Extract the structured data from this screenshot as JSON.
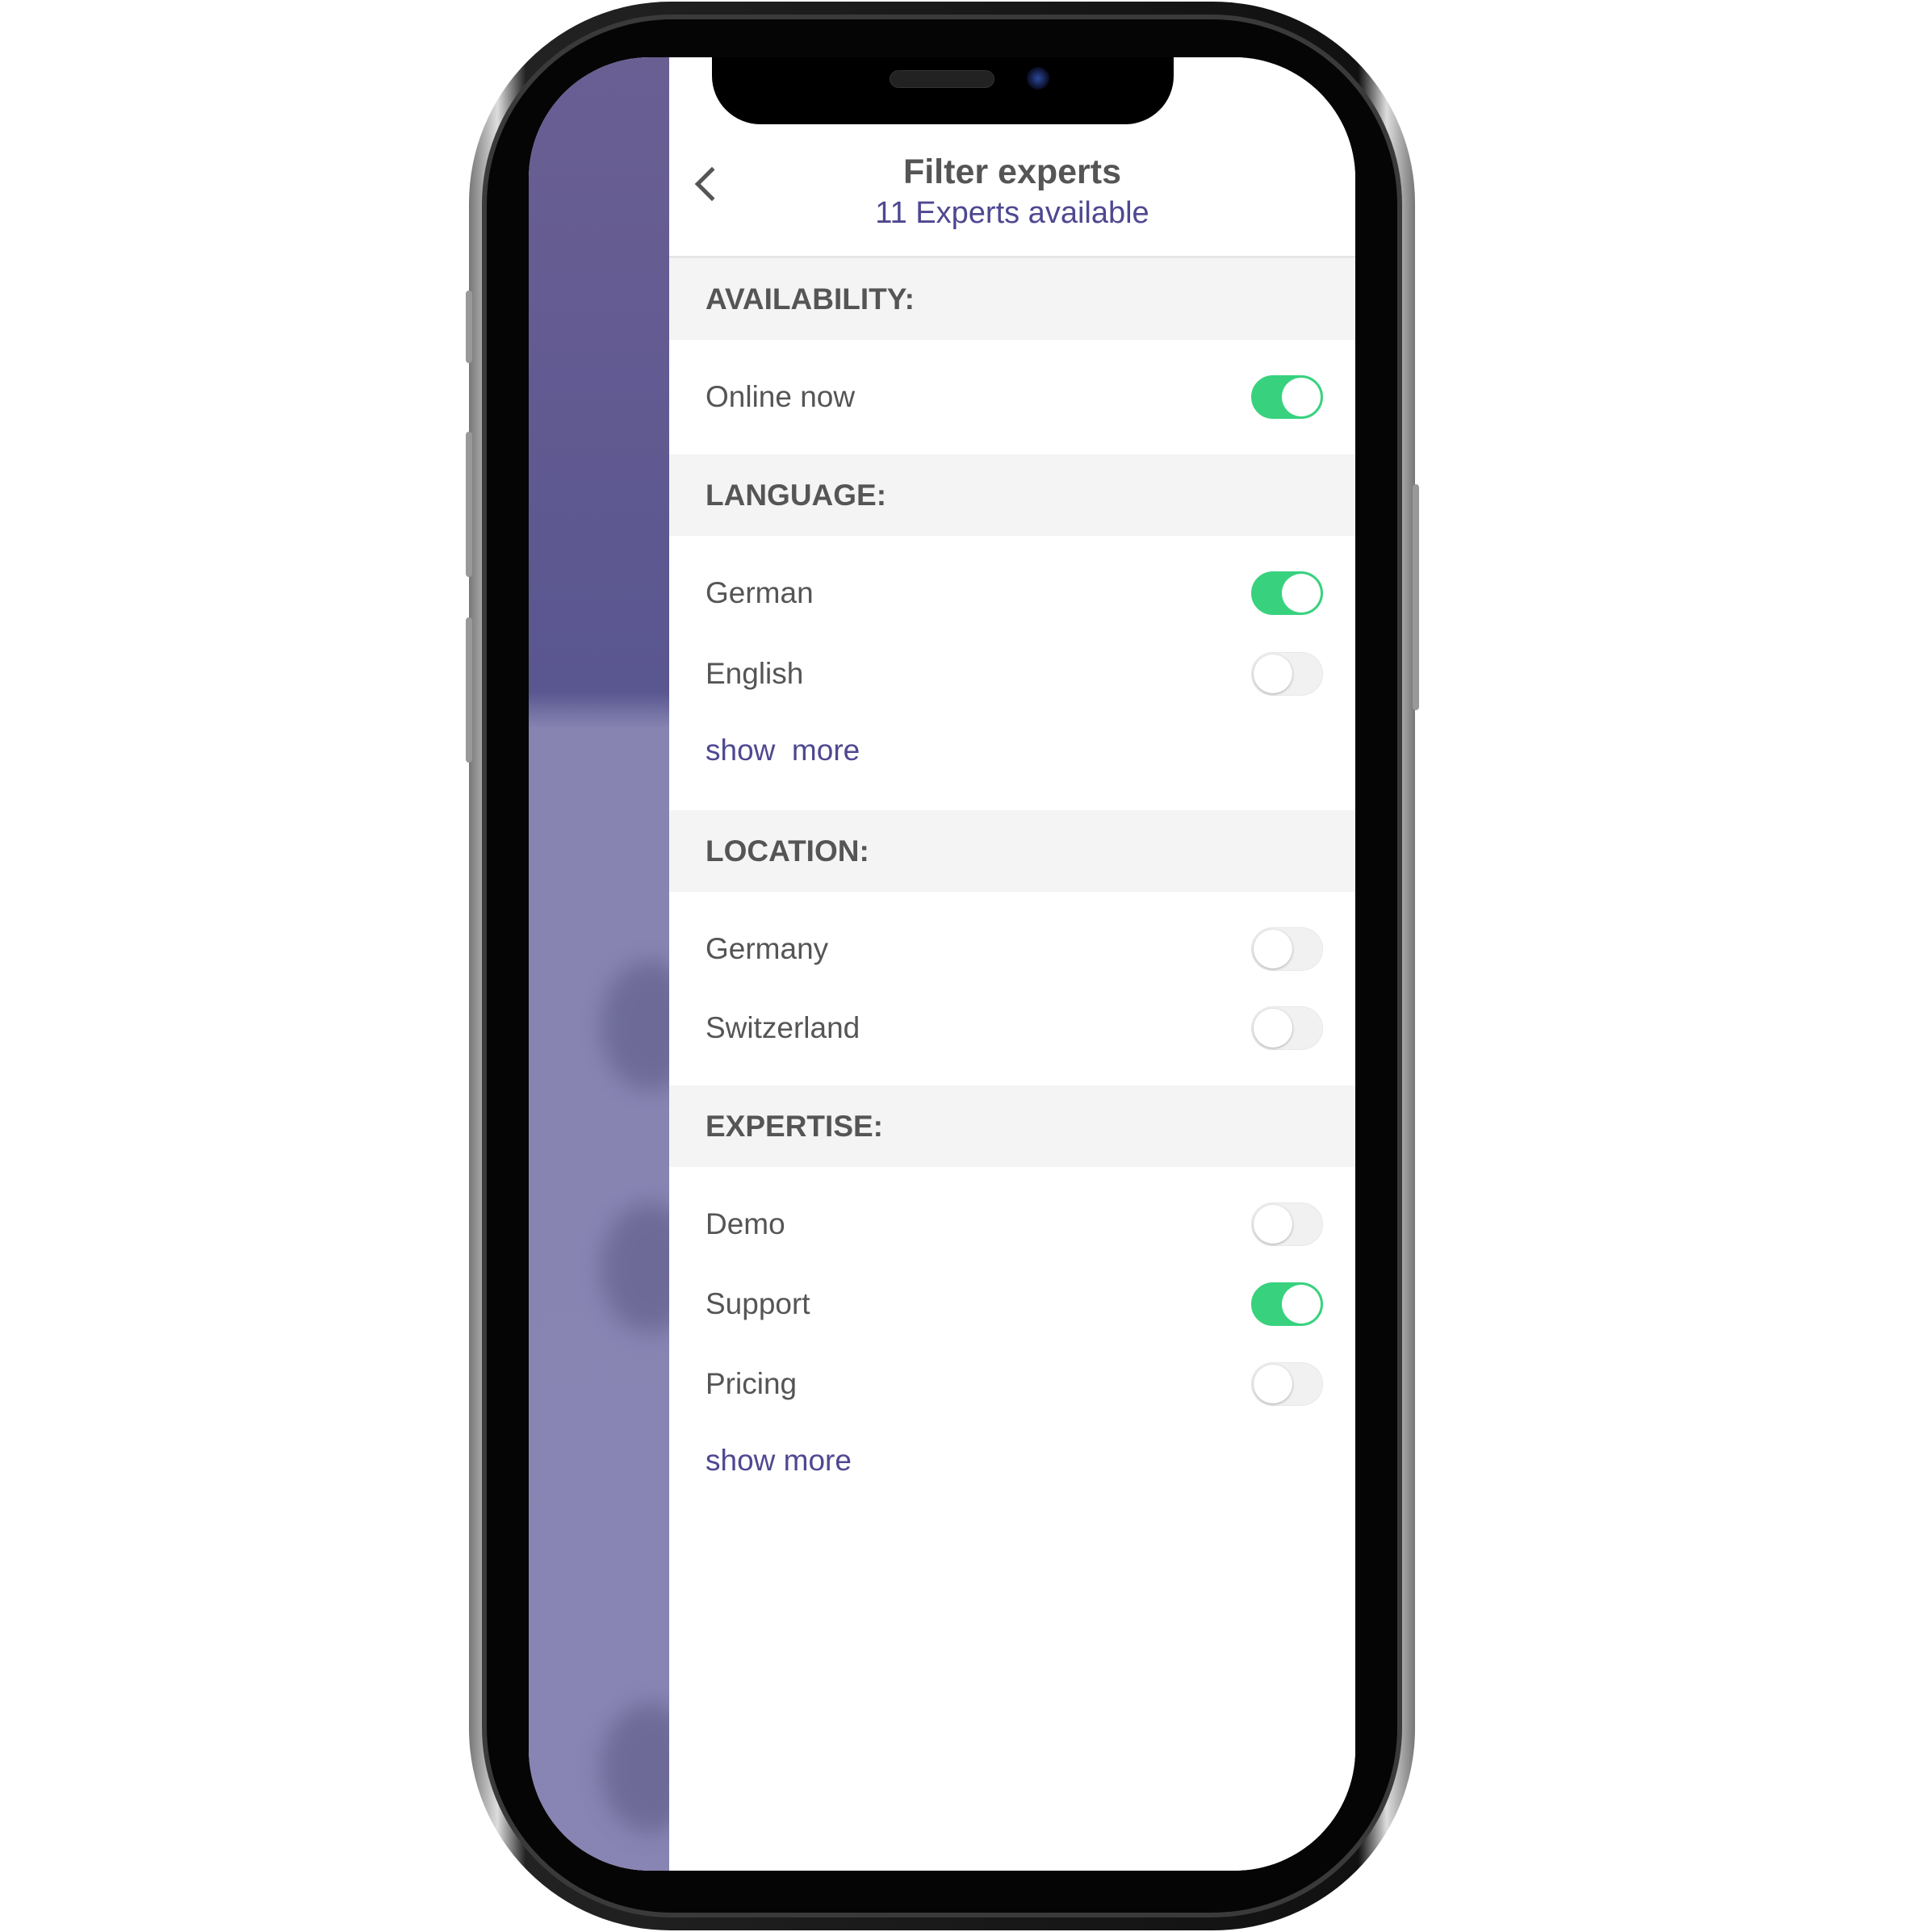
{
  "header": {
    "title": "Filter experts",
    "subtitle": "11 Experts available",
    "back_icon": "chevron-left-icon"
  },
  "colors": {
    "accent": "#4e4891",
    "toggle_on": "#38d27f",
    "section_bg": "#f4f4f4"
  },
  "sections": [
    {
      "title": "AVAILABILITY:",
      "items": [
        {
          "label": "Online now",
          "on": true
        }
      ]
    },
    {
      "title": "LANGUAGE:",
      "items": [
        {
          "label": "German",
          "on": true
        },
        {
          "label": "English",
          "on": false
        }
      ],
      "show_more": "show  more"
    },
    {
      "title": "LOCATION:",
      "items": [
        {
          "label": "Germany",
          "on": false
        },
        {
          "label": "Switzerland",
          "on": false
        }
      ]
    },
    {
      "title": "EXPERTISE:",
      "items": [
        {
          "label": "Demo",
          "on": false
        },
        {
          "label": "Support",
          "on": true
        },
        {
          "label": "Pricing",
          "on": false
        }
      ],
      "show_more": "show more"
    }
  ]
}
